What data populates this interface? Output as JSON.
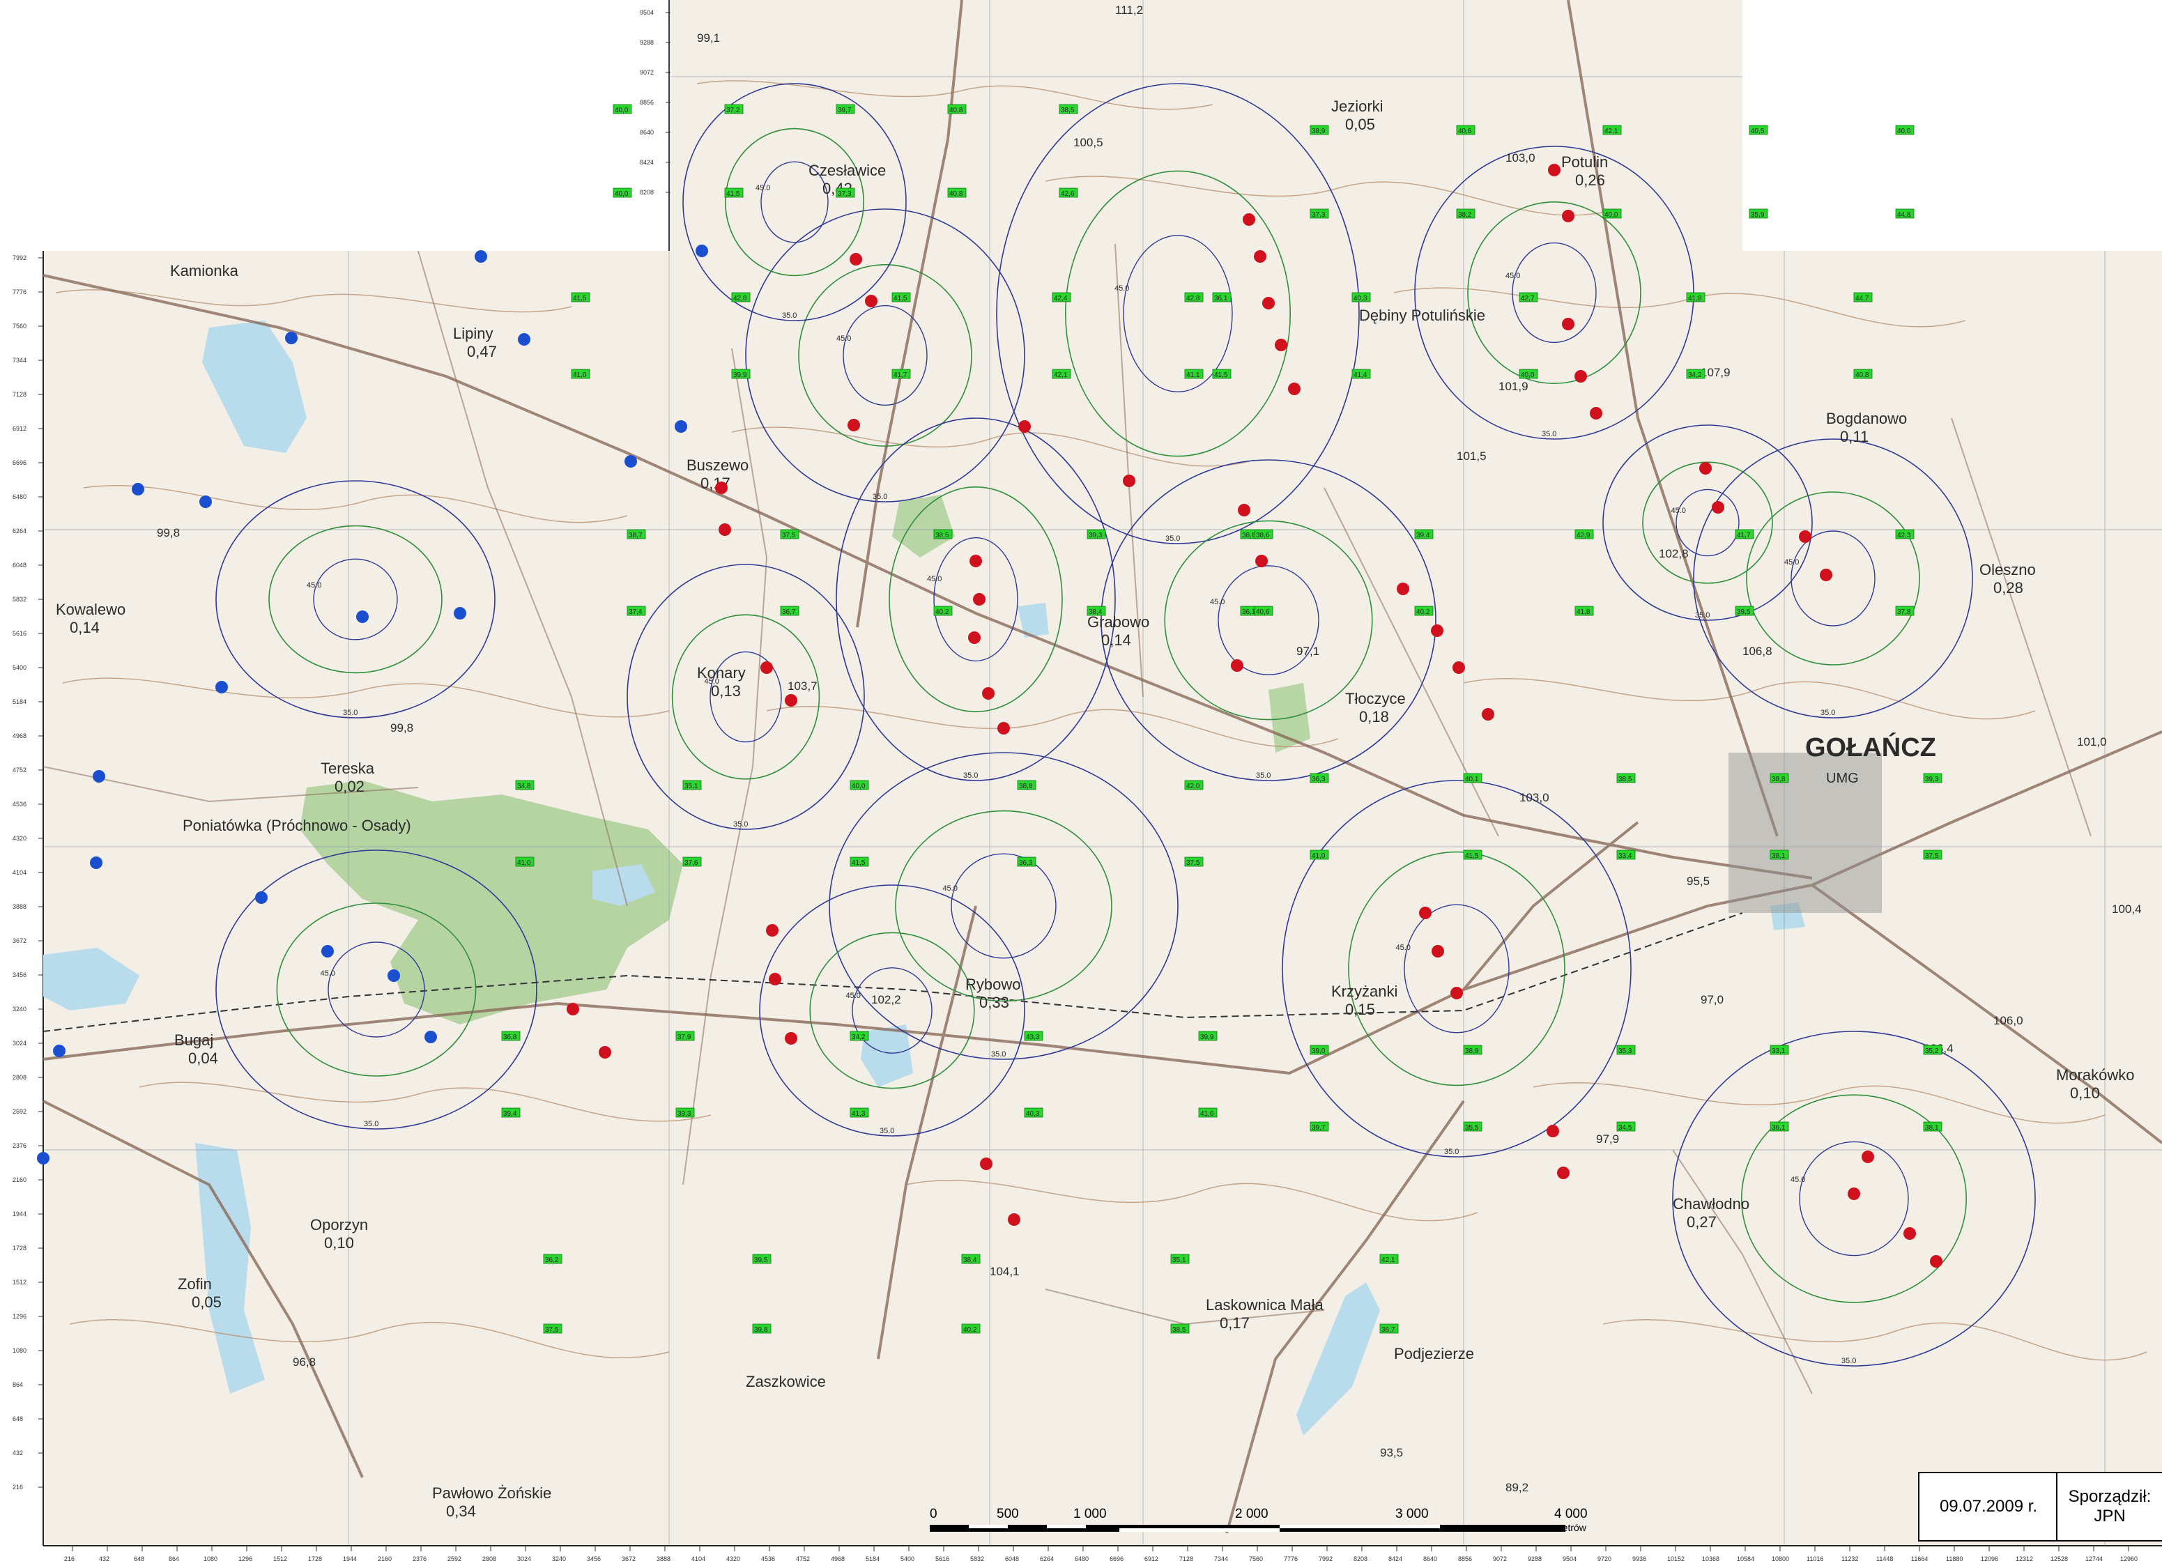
{
  "colors": {
    "paper": "#f3efe6",
    "forest": "#a9cf95",
    "water": "#b8dcec",
    "contour": "#b58c6a",
    "road": "#8a6a5a",
    "grid": "#7f8aa8",
    "turbine_existing": "#d0101c",
    "turbine_planned": "#1a4fd0",
    "isoline_blue": "#303a96",
    "isoline_green": "#2f8f3a",
    "receptor_fill": "#28d62c"
  },
  "places": [
    {
      "name": "Czesławice",
      "value": "0,42"
    },
    {
      "name": "Kamionka",
      "value": ""
    },
    {
      "name": "Lipiny",
      "value": "0,47"
    },
    {
      "name": "Kowalewo",
      "value": "0,14"
    },
    {
      "name": "Tereska",
      "value": "0,02"
    },
    {
      "name": "Poniatówka (Próchnowo - Osady)",
      "value": ""
    },
    {
      "name": "Buszewo",
      "value": "0,17"
    },
    {
      "name": "Konary",
      "value": "0,13"
    },
    {
      "name": "Grabowo",
      "value": "0,14"
    },
    {
      "name": "Rybowo",
      "value": "0,33"
    },
    {
      "name": "Bugaj",
      "value": "0,04"
    },
    {
      "name": "Oporzyn",
      "value": "0,10"
    },
    {
      "name": "Zofin",
      "value": "0,05"
    },
    {
      "name": "Pawłowo Żońskie",
      "value": "0,34"
    },
    {
      "name": "Zaszkowice",
      "value": ""
    },
    {
      "name": "Jeziorki",
      "value": "0,05"
    },
    {
      "name": "Potulin",
      "value": "0,26"
    },
    {
      "name": "Tłoczyce",
      "value": "0,18"
    },
    {
      "name": "Krzyżanki",
      "value": "0,15"
    },
    {
      "name": "Laskownica Mała",
      "value": "0,17"
    },
    {
      "name": "Chawłodno",
      "value": "0,27"
    },
    {
      "name": "Bogdanowo",
      "value": "0,11"
    },
    {
      "name": "Oleszno",
      "value": "0,28"
    },
    {
      "name": "GOŁAŃCZ",
      "value": "UMG"
    },
    {
      "name": "Morakówko",
      "value": "0,10"
    },
    {
      "name": "Podjezierze",
      "value": ""
    },
    {
      "name": "Dębiny Potulińskie",
      "value": ""
    }
  ],
  "spot_heights": [
    "99,1",
    "111,2",
    "103,0",
    "101,5",
    "107,9",
    "106,0",
    "101,0",
    "106,8",
    "99,8",
    "99,8",
    "102,8",
    "103,7",
    "102,2",
    "104,1",
    "96,8",
    "97,0",
    "106,4",
    "97,9",
    "93,5",
    "89,2",
    "97,1",
    "103,0",
    "100,4",
    "100,5",
    "101,9",
    "95,5"
  ],
  "isoline_label": "35.0",
  "isoline_inner_label": "45.0",
  "receptors": [
    "40,0",
    "37,2",
    "39,7",
    "40,8",
    "38,5",
    "40,0",
    "41,5",
    "37,3",
    "40,8",
    "42,6",
    "38,9",
    "40,6",
    "42,1",
    "40,5",
    "40,0",
    "37,3",
    "38,2",
    "40,0",
    "35,9",
    "44,8",
    "41,5",
    "42,8",
    "41,5",
    "42,4",
    "36,1",
    "41,0",
    "39,9",
    "41,7",
    "42,1",
    "41,5",
    "42,8",
    "40,3",
    "42,7",
    "41,8",
    "44,7",
    "41,1",
    "41,4",
    "40,0",
    "34,2",
    "40,8",
    "38,7",
    "37,5",
    "38,5",
    "39,3",
    "38,8",
    "37,4",
    "36,7",
    "40,2",
    "38,4",
    "36,1",
    "38,6",
    "39,4",
    "42,9",
    "41,7",
    "42,3",
    "40,6",
    "40,2",
    "41,8",
    "39,5",
    "37,8",
    "34,8",
    "35,1",
    "40,0",
    "38,8",
    "42,0",
    "41,0",
    "37,6",
    "41,5",
    "36,3",
    "37,5",
    "36,3",
    "40,1",
    "38,5",
    "38,8",
    "39,3",
    "41,0",
    "41,5",
    "33,4",
    "38,1",
    "37,5",
    "36,8",
    "37,9",
    "34,2",
    "43,3",
    "39,9",
    "39,4",
    "39,3",
    "41,3",
    "40,3",
    "41,6",
    "39,0",
    "38,9",
    "35,3",
    "33,1",
    "35,2",
    "39,7",
    "35,5",
    "34,5",
    "36,1",
    "38,1",
    "36,2",
    "39,5",
    "38,4",
    "35,1",
    "42,1",
    "37,5",
    "39,8",
    "40,2",
    "38,5",
    "36,7"
  ],
  "y_axis_ticks_upper": [
    "9504",
    "9288",
    "9072",
    "8856",
    "8640",
    "8424",
    "8208"
  ],
  "y_axis_ticks_main": [
    "7992",
    "7776",
    "7560",
    "7344",
    "7128",
    "6912",
    "6696",
    "6480",
    "6264",
    "6048",
    "5832",
    "5616",
    "5400",
    "5184",
    "4968",
    "4752",
    "4536",
    "4320",
    "4104",
    "3888",
    "3672",
    "3456",
    "3240",
    "3024",
    "2808",
    "2592",
    "2376",
    "2160",
    "1944",
    "1728",
    "1512",
    "1296",
    "1080",
    "864",
    "648",
    "432",
    "216"
  ],
  "x_axis_ticks": [
    "216",
    "432",
    "648",
    "864",
    "1080",
    "1296",
    "1512",
    "1728",
    "1944",
    "2160",
    "2376",
    "2592",
    "2808",
    "3024",
    "3240",
    "3456",
    "3672",
    "3888",
    "4104",
    "4320",
    "4536",
    "4752",
    "4968",
    "5184",
    "5400",
    "5616",
    "5832",
    "6048",
    "6264",
    "6480",
    "6696",
    "6912",
    "7128",
    "7344",
    "7560",
    "7776",
    "7992",
    "8208",
    "8424",
    "8640",
    "8856",
    "9072",
    "9288",
    "9504",
    "9720",
    "9936",
    "10152",
    "10368",
    "10584",
    "10800",
    "11016",
    "11232",
    "11448",
    "11664",
    "11880",
    "12096",
    "12312",
    "12528",
    "12744",
    "12960"
  ],
  "scale_bar": {
    "labels": [
      "0",
      "500",
      "1 000",
      "2 000",
      "3 000",
      "4 000"
    ],
    "unit": "metrów"
  },
  "footer": {
    "date": "09.07.2009 r.",
    "author_label": "Sporządził:",
    "author": "JPN"
  }
}
